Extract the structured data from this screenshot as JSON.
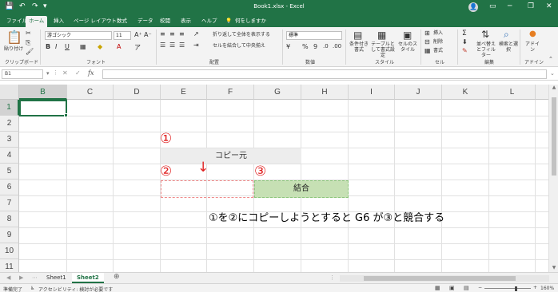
{
  "window": {
    "title": "Book1.xlsx - Excel",
    "avatar": "👤",
    "minimize": "─",
    "restore": "❐",
    "close": "✕",
    "quick_access": [
      "💾",
      "↶",
      "↷",
      "▾"
    ]
  },
  "tabs": [
    "ファイル",
    "ホーム",
    "挿入",
    "ページ レイアウト",
    "数式",
    "データ",
    "校閲",
    "表示",
    "ヘルプ",
    "何をしますか"
  ],
  "ribbon": {
    "groups": {
      "clipboard": "クリップボード",
      "font": "フォント",
      "alignment": "配置",
      "number": "数値",
      "styles": "スタイル",
      "cells": "セル",
      "editing": "編集",
      "addins": "アドイン"
    },
    "paste_label": "貼り付け",
    "font_name": "游ゴシック",
    "font_size": "11",
    "wrap_text": "折り返して全体を表示する",
    "merge_center": "セルを結合して中央揃え",
    "number_format": "標準",
    "conditional_format": "条件付き書式",
    "format_as_table": "テーブルとして書式設定",
    "cell_styles": "セルのスタイル",
    "insert": "挿入",
    "delete": "削除",
    "format": "書式",
    "sort_filter": "並べ替えとフィルター",
    "find_select": "検索と選択",
    "addin": "アドイン"
  },
  "formula_bar": {
    "name_box": "B1",
    "fx": "fx",
    "value": ""
  },
  "grid": {
    "columns": [
      "B",
      "C",
      "D",
      "E",
      "F",
      "G",
      "H",
      "I",
      "J",
      "K",
      "L"
    ],
    "rows": [
      "1",
      "2",
      "3",
      "4",
      "5",
      "6",
      "7",
      "8",
      "9",
      "10",
      "11"
    ],
    "selected_column": "B",
    "selected_row": "1"
  },
  "annotations": {
    "circle1": "①",
    "circle2": "②",
    "circle3": "③",
    "arrow": "↓",
    "copy_source_text": "コピー元",
    "merged_text": "結合",
    "note": "①を②にコピーしようとすると G6 が③と競合する"
  },
  "sheets": [
    "Sheet1",
    "Sheet2"
  ],
  "active_sheet": "Sheet2",
  "add_sheet": "⊕",
  "status": {
    "ready": "準備完了",
    "accessibility": "アクセシビリティ: 検討が必要です",
    "zoom": "160%"
  },
  "colors": {
    "accent": "#217346",
    "merged_fill": "#c6e0b4",
    "annotation_red": "#e02020"
  }
}
